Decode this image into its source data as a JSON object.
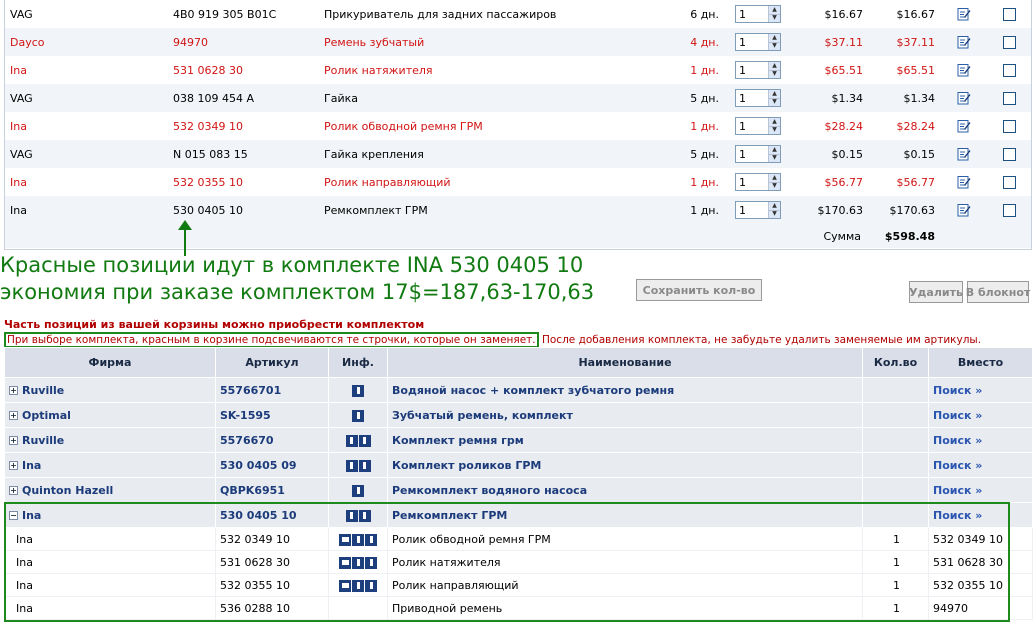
{
  "cart": {
    "rows": [
      {
        "brand": "VAG",
        "article": "4B0 919 305 B01C",
        "name": "Прикуриватель для задних пассажиров",
        "days": "6 дн.",
        "qty": "1",
        "price": "$16.67",
        "total": "$16.67",
        "highlight": false
      },
      {
        "brand": "Dayco",
        "article": "94970",
        "name": "Ремень зубчатый",
        "days": "4 дн.",
        "qty": "1",
        "price": "$37.11",
        "total": "$37.11",
        "highlight": true
      },
      {
        "brand": "Ina",
        "article": "531 0628 30",
        "name": "Ролик натяжителя",
        "days": "1 дн.",
        "qty": "1",
        "price": "$65.51",
        "total": "$65.51",
        "highlight": true
      },
      {
        "brand": "VAG",
        "article": "038 109 454 A",
        "name": "Гайка",
        "days": "5 дн.",
        "qty": "1",
        "price": "$1.34",
        "total": "$1.34",
        "highlight": false
      },
      {
        "brand": "Ina",
        "article": "532 0349 10",
        "name": "Ролик обводной ремня ГРМ",
        "days": "1 дн.",
        "qty": "1",
        "price": "$28.24",
        "total": "$28.24",
        "highlight": true
      },
      {
        "brand": "VAG",
        "article": "N 015 083 15",
        "name": "Гайка крепления",
        "days": "5 дн.",
        "qty": "1",
        "price": "$0.15",
        "total": "$0.15",
        "highlight": false
      },
      {
        "brand": "Ina",
        "article": "532 0355 10",
        "name": "Ролик направляющий",
        "days": "1 дн.",
        "qty": "1",
        "price": "$56.77",
        "total": "$56.77",
        "highlight": true
      },
      {
        "brand": "Ina",
        "article": "530 0405 10",
        "name": "Ремкомплект ГРМ",
        "days": "1 дн.",
        "qty": "1",
        "price": "$170.63",
        "total": "$170.63",
        "highlight": false
      }
    ],
    "sum_label": "Сумма",
    "sum_value": "$598.48"
  },
  "annotation": {
    "line1": "Красные позиции идут в комплекте INA 530 0405 10",
    "line2": "экономия при заказе комплектом 17$=187,63-170,63"
  },
  "buttons": {
    "save_qty": "Сохранить кол-во",
    "delete": "Удалить",
    "to_notepad": "В блокнот"
  },
  "kits": {
    "heading": "Часть позиций из вашей корзины можно приобрести комплектом",
    "notice_boxed": "При выборе комплекта, красным в корзине подсвечиваются те строчки, которые он заменяет.",
    "notice_rest": " После добавления комплекта, не забудьте удалить заменяемые им артикулы.",
    "columns": {
      "brand": "Фирма",
      "article": "Артикул",
      "info": "Инф.",
      "name": "Наименование",
      "qty": "Кол.во",
      "instead": "Вместо"
    },
    "groups": [
      {
        "expander": "+",
        "brand": "Ruville",
        "article": "55766701",
        "icons": 1,
        "name": "Водяной насос + комплект зубчатого ремня",
        "search": "Поиск »"
      },
      {
        "expander": "+",
        "brand": "Optimal",
        "article": "SK-1595",
        "icons": 1,
        "name": "Зубчатый ремень, комплект",
        "search": "Поиск »"
      },
      {
        "expander": "+",
        "brand": "Ruville",
        "article": "5576670",
        "icons": 2,
        "name": "Комплект ремня грм",
        "search": "Поиск »"
      },
      {
        "expander": "+",
        "brand": "Ina",
        "article": "530 0405 09",
        "icons": 2,
        "name": "Комплект роликов ГРМ",
        "search": "Поиск »"
      },
      {
        "expander": "+",
        "brand": "Quinton Hazell",
        "article": "QBPK6951",
        "icons": 1,
        "name": "Ремкомплект водяного насоса",
        "search": "Поиск »"
      },
      {
        "expander": "−",
        "brand": "Ina",
        "article": "530 0405 10",
        "icons": 2,
        "name": "Ремкомплект ГРМ",
        "search": "Поиск »"
      }
    ],
    "components": [
      {
        "brand": "Ina",
        "article": "532 0349 10",
        "icons": 3,
        "name": "Ролик обводной ремня ГРМ",
        "qty": "1",
        "instead": "532 0349 10"
      },
      {
        "brand": "Ina",
        "article": "531 0628 30",
        "icons": 3,
        "name": "Ролик натяжителя",
        "qty": "1",
        "instead": "531 0628 30"
      },
      {
        "brand": "Ina",
        "article": "532 0355 10",
        "icons": 3,
        "name": "Ролик направляющий",
        "qty": "1",
        "instead": "532 0355 10"
      },
      {
        "brand": "Ina",
        "article": "536 0288 10",
        "icons": 0,
        "name": "Приводной ремень",
        "qty": "1",
        "instead": "94970"
      }
    ]
  },
  "colors": {
    "highlight_text": "#d21414",
    "annotation_green": "#117a11",
    "link_blue": "#1b3b7a"
  }
}
